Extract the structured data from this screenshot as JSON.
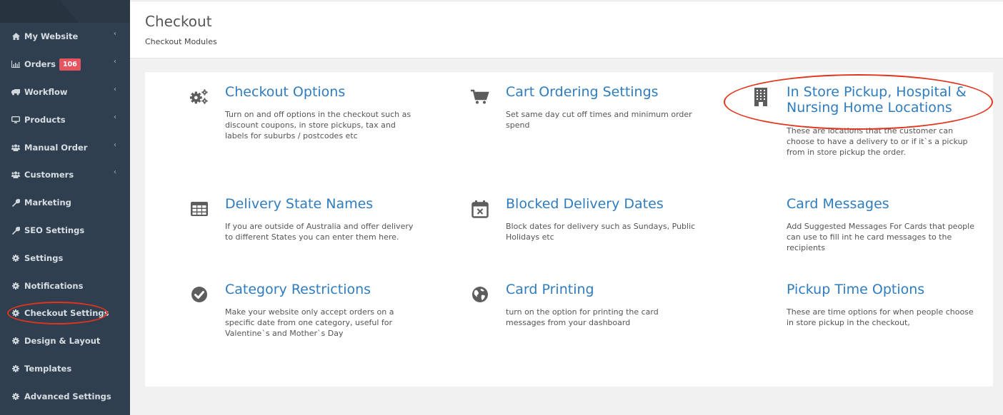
{
  "sidebar": {
    "items": [
      {
        "label": "My Website",
        "icon": "home-icon",
        "chevron": true
      },
      {
        "label": "Orders",
        "icon": "bar-chart-icon",
        "chevron": true,
        "badge": "106"
      },
      {
        "label": "Workflow",
        "icon": "truck-icon",
        "chevron": true
      },
      {
        "label": "Products",
        "icon": "desktop-icon",
        "chevron": true
      },
      {
        "label": "Manual Order",
        "icon": "users-icon",
        "chevron": true
      },
      {
        "label": "Customers",
        "icon": "users-icon",
        "chevron": true
      },
      {
        "label": "Marketing",
        "icon": "wrench-icon",
        "chevron": false
      },
      {
        "label": "SEO Settings",
        "icon": "wrench-icon",
        "chevron": false
      },
      {
        "label": "Settings",
        "icon": "gear-icon",
        "chevron": false
      },
      {
        "label": "Notifications",
        "icon": "gear-icon",
        "chevron": false
      },
      {
        "label": "Checkout Settings",
        "icon": "gear-icon",
        "chevron": false,
        "highlighted": true
      },
      {
        "label": "Design & Layout",
        "icon": "gear-icon",
        "chevron": false
      },
      {
        "label": "Templates",
        "icon": "gear-icon",
        "chevron": false
      },
      {
        "label": "Advanced Settings",
        "icon": "gear-icon",
        "chevron": false
      }
    ],
    "chevron_glyph": "‹",
    "badge_color": "#e5545f"
  },
  "header": {
    "title": "Checkout",
    "subtitle": "Checkout Modules"
  },
  "modules": [
    {
      "title": "Checkout Options",
      "icon": "gears-icon",
      "description": "Turn on and off options in the checkout such as discount coupons, in store pickups, tax and labels for suburbs / postcodes etc"
    },
    {
      "title": "Cart Ordering Settings",
      "icon": "shopping-cart-icon",
      "description": "Set same day cut off times and minimum order spend"
    },
    {
      "title": "In Store Pickup, Hospital & Nursing Home Locations",
      "title_line1": "In Store Pickup, Hospital &",
      "title_line2": "Nursing Home Locations",
      "icon": "building-icon",
      "description": "These are locations that the customer can choose to have a delivery to or if it`s a pickup from in store pickup the order.",
      "highlighted": true
    },
    {
      "title": "Delivery State Names",
      "icon": "table-icon",
      "description": "If you are outside of Australia and offer delivery to different States you can enter them here."
    },
    {
      "title": "Blocked Delivery Dates",
      "icon": "calendar-times-icon",
      "description": "Block dates for delivery such as Sundays, Public Holidays etc"
    },
    {
      "title": "Card Messages",
      "icon": "",
      "description": "Add Suggested Messages For Cards that people can use to fill int he card messages to the recipients"
    },
    {
      "title": "Category Restrictions",
      "icon": "check-circle-icon",
      "description": "Make your website only accept orders on a specific date from one category, useful for Valentine`s and Mother`s Day"
    },
    {
      "title": "Card Printing",
      "icon": "globe-icon",
      "description": "turn on the option for printing the card messages from your dashboard"
    },
    {
      "title": "Pickup Time Options",
      "icon": "",
      "description": "These are time options for when people choose in store pickup in the checkout,"
    }
  ],
  "colors": {
    "sidebar_bg": "#2f3f4f",
    "link_blue": "#2f7cbf",
    "annotation_red": "#e2341d"
  }
}
